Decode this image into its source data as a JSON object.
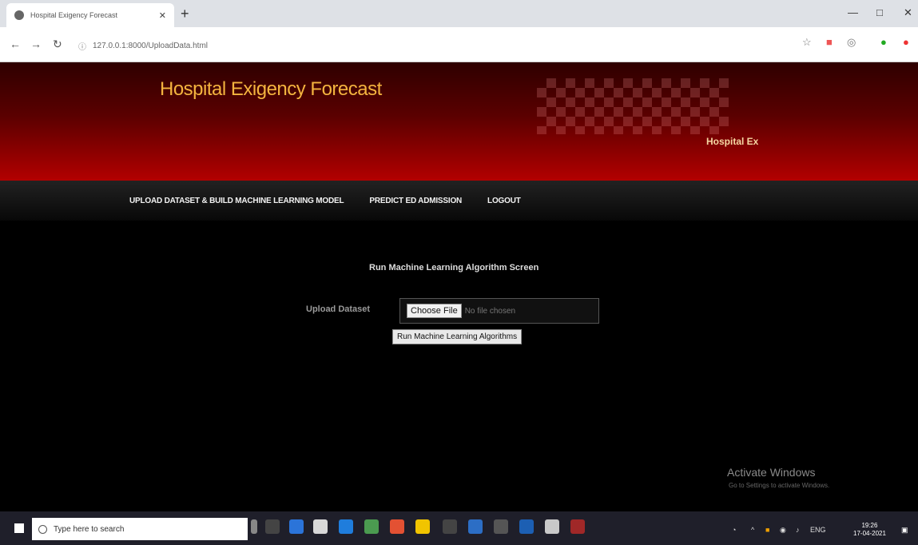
{
  "browser": {
    "tab_title": "Hospital Exigency Forecast",
    "url": "127.0.0.1:8000/UploadData.html"
  },
  "site": {
    "title": "Hospital Exigency Forecast",
    "header_sub": "Hospital Ex",
    "nav": [
      "UPLOAD DATASET & BUILD MACHINE LEARNING MODEL",
      "PREDICT ED ADMISSION",
      "LOGOUT"
    ]
  },
  "page": {
    "screen_title": "Run Machine Learning Algorithm Screen",
    "upload_label": "Upload Dataset",
    "choose_file": "Choose File",
    "no_file": "No file chosen",
    "run_button": "Run Machine Learning Algorithms"
  },
  "windows": {
    "activate_title": "Activate Windows",
    "activate_sub": "Go to Settings to activate Windows.",
    "search_placeholder": "Type here to search",
    "clock_time": "19:26",
    "clock_date": "17-04-2021",
    "language": "ENG"
  }
}
